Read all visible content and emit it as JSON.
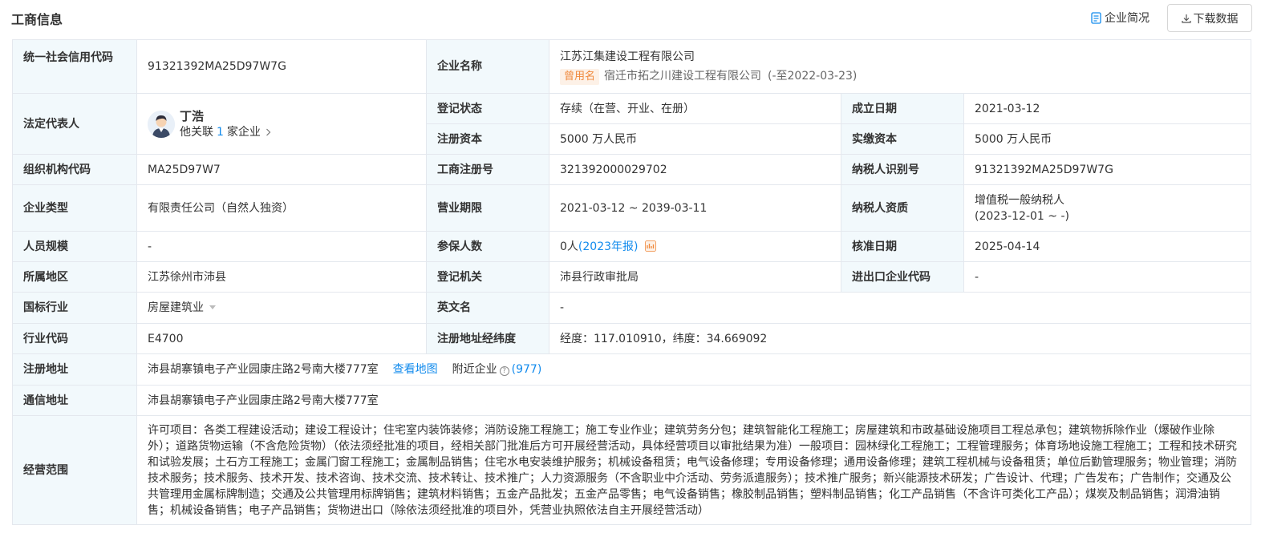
{
  "header": {
    "title": "工商信息",
    "overview_label": "企业简况",
    "download_label": "下载数据",
    "overview_icon": "document-icon",
    "download_icon": "download-icon"
  },
  "colors": {
    "label_bg": "#f2f9fc",
    "border": "#e4e8ee",
    "link": "#128bed",
    "tag_bg": "#fdf1e7",
    "tag_text": "#f0893c"
  },
  "labels": {
    "credit_code": "统一社会信用代码",
    "company_name": "企业名称",
    "legal_rep": "法定代表人",
    "reg_status": "登记状态",
    "found_date": "成立日期",
    "reg_capital": "注册资本",
    "paid_capital": "实缴资本",
    "org_code": "组织机构代码",
    "biz_reg_no": "工商注册号",
    "taxpayer_id": "纳税人识别号",
    "company_type": "企业类型",
    "biz_term": "营业期限",
    "taxpayer_qual": "纳税人资质",
    "staff_size": "人员规模",
    "insured": "参保人数",
    "approve_date": "核准日期",
    "region": "所属地区",
    "reg_authority": "登记机关",
    "ie_code": "进出口企业代码",
    "industry": "国标行业",
    "english_name": "英文名",
    "industry_code": "行业代码",
    "geo": "注册地址经纬度",
    "reg_address": "注册地址",
    "mail_address": "通信地址",
    "biz_scope": "经营范围"
  },
  "values": {
    "credit_code": "91321392MA25D97W7G",
    "company_name": "江苏江集建设工程有限公司",
    "former_tag": "曾用名",
    "former_name": "宿迁市拓之川建设工程有限公司",
    "former_date": "(-至2022-03-23)",
    "legal_rep_name": "丁浩",
    "legal_rep_prefix": "他关联",
    "legal_rep_count": "1",
    "legal_rep_suffix": "家企业",
    "reg_status": "存续（在营、开业、在册）",
    "found_date": "2021-03-12",
    "reg_capital": "5000 万人民币",
    "paid_capital": "5000 万人民币",
    "org_code": "MA25D97W7",
    "biz_reg_no": "321392000029702",
    "taxpayer_id": "91321392MA25D97W7G",
    "company_type": "有限责任公司（自然人独资）",
    "biz_term": "2021-03-12 ~ 2039-03-11",
    "taxpayer_qual_1": "增值税一般纳税人",
    "taxpayer_qual_2": "(2023-12-01 ~ -)",
    "staff_size": "-",
    "insured_count": "0人",
    "insured_report": "(2023年报)",
    "approve_date": "2025-04-14",
    "region": "江苏徐州市沛县",
    "reg_authority": "沛县行政审批局",
    "ie_code": "-",
    "industry": "房屋建筑业",
    "english_name": "-",
    "industry_code": "E4700",
    "geo": "经度：117.010910，纬度：34.669092",
    "reg_address": "沛县胡寨镇电子产业园康庄路2号南大楼777室",
    "map_link": "查看地图",
    "nearby_label": "附近企业",
    "nearby_count": "(977)",
    "mail_address": "沛县胡寨镇电子产业园康庄路2号南大楼777室",
    "biz_scope": "许可项目：各类工程建设活动；建设工程设计；住宅室内装饰装修；消防设施工程施工；施工专业作业；建筑劳务分包；建筑智能化工程施工；房屋建筑和市政基础设施项目工程总承包；建筑物拆除作业（爆破作业除外）；道路货物运输（不含危险货物）（依法须经批准的项目，经相关部门批准后方可开展经营活动，具体经营项目以审批结果为准）一般项目：园林绿化工程施工；工程管理服务；体育场地设施工程施工；工程和技术研究和试验发展；土石方工程施工；金属门窗工程施工；金属制品销售；住宅水电安装维护服务；机械设备租赁；电气设备修理；专用设备修理；通用设备修理；建筑工程机械与设备租赁；单位后勤管理服务；物业管理；消防技术服务；技术服务、技术开发、技术咨询、技术交流、技术转让、技术推广；人力资源服务（不含职业中介活动、劳务派遣服务）；技术推广服务；新兴能源技术研发；广告设计、代理；广告发布；广告制作；交通及公共管理用金属标牌制造；交通及公共管理用标牌销售；建筑材料销售；五金产品批发；五金产品零售；电气设备销售；橡胶制品销售；塑料制品销售；化工产品销售（不含许可类化工产品）；煤炭及制品销售；润滑油销售；机械设备销售；电子产品销售；货物进出口（除依法须经批准的项目外，凭营业执照依法自主开展经营活动）"
  }
}
